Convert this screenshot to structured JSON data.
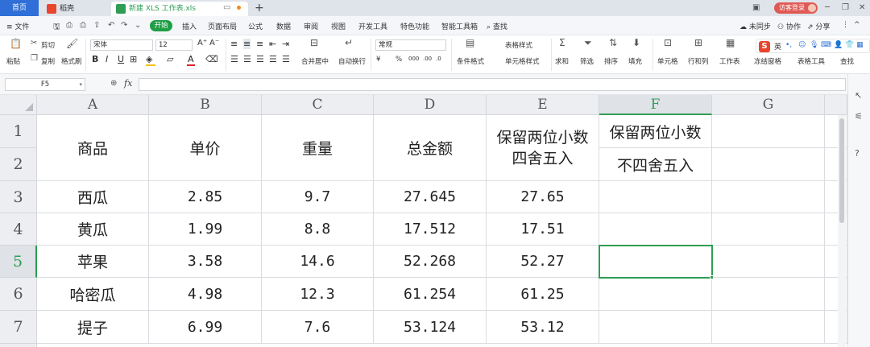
{
  "titlebar": {
    "home_tab": "首页",
    "wps_tab": "稻壳",
    "doc_tab": "新建 XLS 工作表.xls",
    "new_tab": "+",
    "guest_label": "访客登录"
  },
  "menubar": {
    "file": "≡ 文件",
    "tabs": [
      "开始",
      "插入",
      "页面布局",
      "公式",
      "数据",
      "审阅",
      "视图",
      "开发工具",
      "特色功能",
      "智能工具箱"
    ],
    "search": "查找",
    "sync": "未同步",
    "collab": "协作",
    "share": "分享"
  },
  "ribbon": {
    "cut": "剪切",
    "paste": "粘贴",
    "copy": "复制",
    "format_painter": "格式刷",
    "font_name": "宋体",
    "font_size": "12",
    "merge_center": "合并居中",
    "wrap_text": "自动换行",
    "number_format": "常规",
    "conditional_format": "条件格式",
    "table_style": "表格样式",
    "cell_style": "单元格样式",
    "sum": "求和",
    "filter": "筛选",
    "sort": "排序",
    "fill": "填充",
    "cell": "单元格",
    "row_col": "行和列",
    "worksheet": "工作表",
    "freeze": "冻结窗格",
    "table_tools": "表格工具",
    "find": "查找"
  },
  "ime": {
    "lang": "英"
  },
  "formulabar": {
    "name_box": "F5",
    "fx_label": "fx",
    "formula": ""
  },
  "grid": {
    "columns": [
      "A",
      "B",
      "C",
      "D",
      "E",
      "F",
      "G"
    ],
    "selected_column": "F",
    "rows": [
      "1",
      "2",
      "3",
      "4",
      "5",
      "6",
      "7"
    ],
    "selected_row": "5",
    "headers": {
      "a": "商品",
      "b": "单价",
      "c": "重量",
      "d": "总金额",
      "e_line1": "保留两位小数",
      "e_line2": "四舍五入",
      "f1": "保留两位小数",
      "f2": "不四舍五入"
    },
    "data": [
      {
        "name": "西瓜",
        "price": "2.85",
        "weight": "9.7",
        "total": "27.645",
        "rounded": "27.65"
      },
      {
        "name": "黄瓜",
        "price": "1.99",
        "weight": "8.8",
        "total": "17.512",
        "rounded": "17.51"
      },
      {
        "name": "苹果",
        "price": "3.58",
        "weight": "14.6",
        "total": "52.268",
        "rounded": "52.27"
      },
      {
        "name": "哈密瓜",
        "price": "4.98",
        "weight": "12.3",
        "total": "61.254",
        "rounded": "61.25"
      },
      {
        "name": "提子",
        "price": "6.99",
        "weight": "7.6",
        "total": "53.124",
        "rounded": "53.12"
      }
    ]
  },
  "colors": {
    "accent_green": "#2e9e54",
    "home_tab_blue": "#2f6fd7",
    "guest_red": "#e05a55"
  }
}
